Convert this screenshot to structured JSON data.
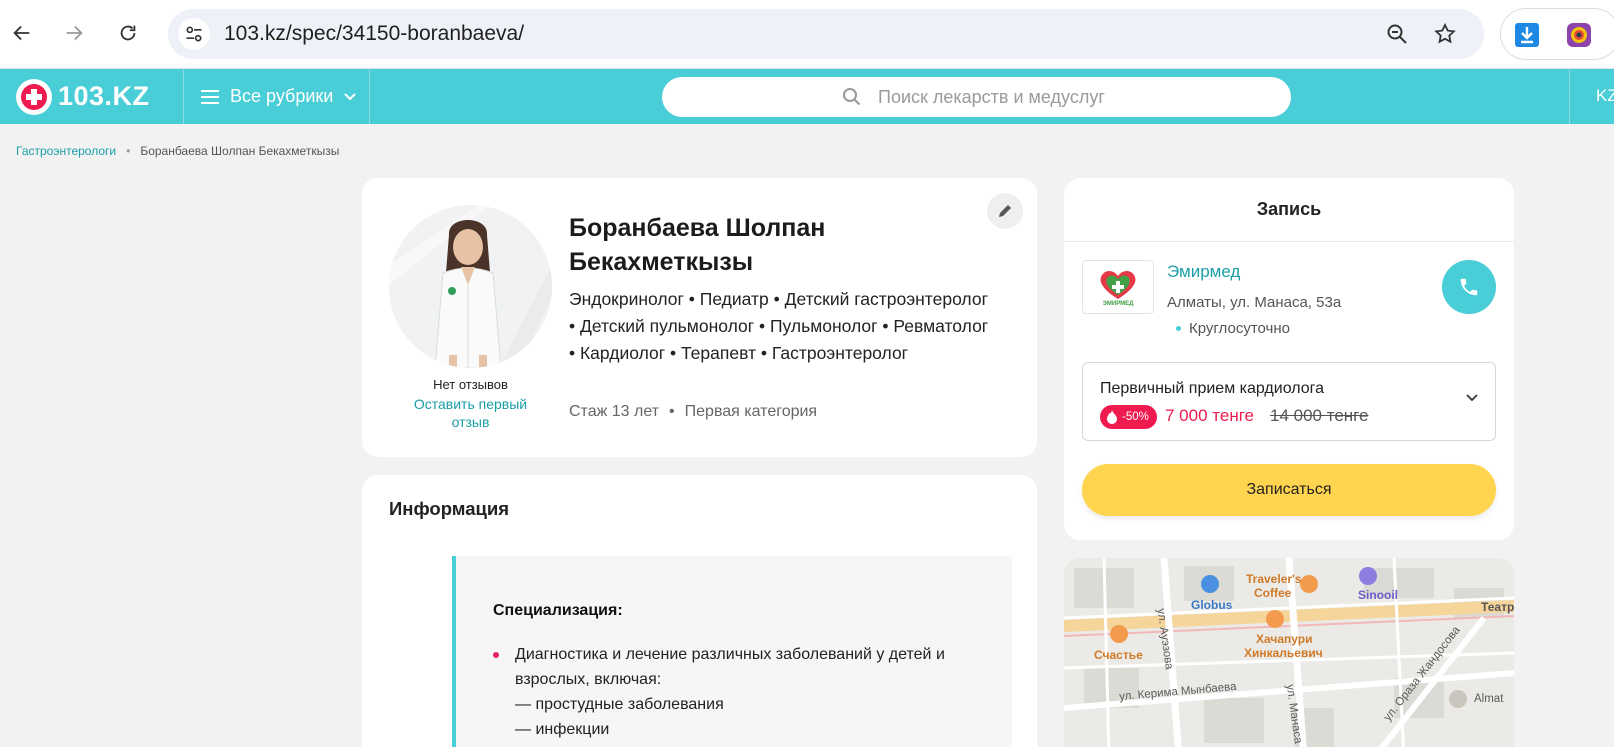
{
  "browser": {
    "url": "103.kz/spec/34150-boranbaeva/"
  },
  "header": {
    "logo_text": "103.KZ",
    "rubrics_label": "Все рубрики",
    "search_placeholder": "Поиск лекарств и медуслуг",
    "lang": "KZ"
  },
  "breadcrumb": {
    "parent": "Гастроэнтерологи",
    "separator": "•",
    "current": "Боранбаева Шолпан Бекахметкызы"
  },
  "profile": {
    "name": "Боранбаева Шолпан Бекахметкызы",
    "specialties": "Эндокринолог • Педиатр • Детский гастроэнтеролог • Детский пульмонолог • Пульмонолог • Ревматолог • Кардиолог • Терапевт • Гастроэнтеролог",
    "experience": "Стаж 13 лет",
    "exp_separator": "•",
    "category": "Первая категория",
    "reviews_label": "Нет отзывов",
    "leave_review": "Оставить первый отзыв"
  },
  "info": {
    "title": "Информация",
    "subtitle": "Специализация:",
    "item_main": "Диагностика и лечение различных заболеваний у детей и взрослых, включая:",
    "sub_items": [
      "— простудные заболевания",
      "— инфекции"
    ]
  },
  "booking": {
    "title": "Запись",
    "clinic_name": "Эмирмед",
    "clinic_logo_text": "ЭМИРМЕД",
    "clinic_address": "Алматы, ул. Манаса, 53а",
    "clinic_hours": "Круглосуточно",
    "service_name": "Первичный прием кардиолога",
    "discount": "-50%",
    "price_new": "7 000 тенге",
    "price_old": "14 000 тенге",
    "book_button": "Записаться"
  },
  "map": {
    "labels": {
      "globus": "Globus",
      "travelers": "Traveler's",
      "coffee": "Coffee",
      "sinooil": "Sinooil",
      "teatr": "Театр",
      "schastye": "Счастье",
      "khachapuri": "Хачапури",
      "khinkalevich": "Хинкальевич",
      "auezova": "ул. Ауэзова",
      "manasa": "ул. Манаса",
      "mynbaeva": "ул. Керима Мынбаева",
      "zhandosova": "ул. Ораза Жандосова",
      "almaty": "Almat"
    }
  },
  "colors": {
    "brand": "#49cdd6",
    "link": "#1a9ea8",
    "accent_red": "#ef1a4f",
    "button_yellow": "#ffd54f"
  }
}
